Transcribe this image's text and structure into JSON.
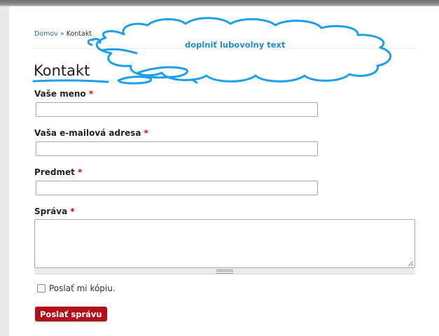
{
  "breadcrumb": {
    "home": "Domov",
    "separator": "»",
    "current": "Kontakt"
  },
  "page": {
    "title": "Kontakt"
  },
  "annotation": {
    "text": "doplniť lubovolny text",
    "color": "#1ea0e6"
  },
  "form": {
    "name_label": "Vaše meno",
    "email_label": "Vaša e-mailová adresa",
    "subject_label": "Predmet",
    "message_label": "Správa",
    "required_mark": "*",
    "name_value": "",
    "email_value": "",
    "subject_value": "",
    "message_value": "",
    "copy_checkbox": {
      "label": "Poslať mi kópiu.",
      "checked": false
    },
    "submit_label": "Poslať správu"
  },
  "colors": {
    "accent": "#b20f18",
    "link": "#2a6db0",
    "required": "#d0021b"
  }
}
